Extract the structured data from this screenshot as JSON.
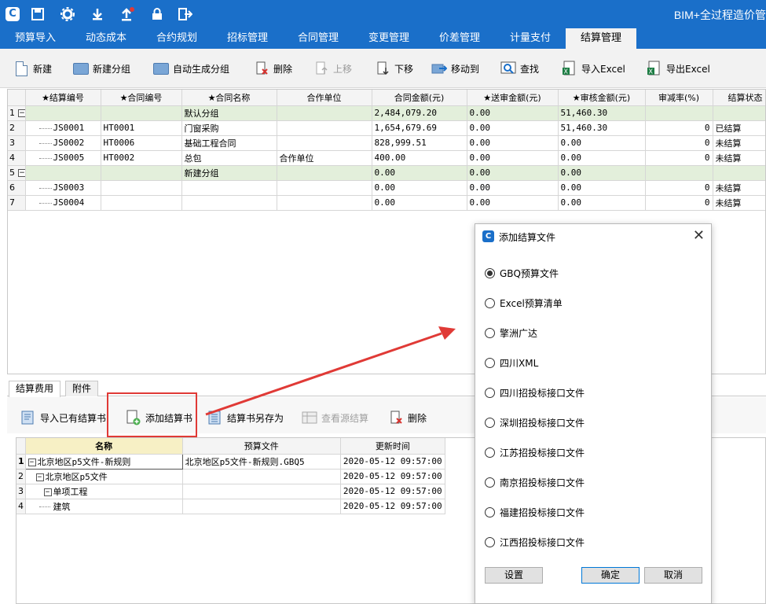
{
  "app_title": "BIM+全过程造价管",
  "menu": {
    "tabs": [
      "预算导入",
      "动态成本",
      "合约规划",
      "招标管理",
      "合同管理",
      "变更管理",
      "价差管理",
      "计量支付",
      "结算管理"
    ],
    "active_index": 8
  },
  "toolbar": {
    "new": "新建",
    "new_group": "新建分组",
    "auto_group": "自动生成分组",
    "delete": "删除",
    "move_up": "上移",
    "move_down": "下移",
    "move_to": "移动到",
    "find": "查找",
    "import_excel": "导入Excel",
    "export_excel": "导出Excel"
  },
  "top_grid": {
    "headers": [
      "★结算编号",
      "★合同编号",
      "★合同名称",
      "合作单位",
      "合同金额(元)",
      "★送审金额(元)",
      "★审核金额(元)",
      "审减率(%)",
      "结算状态"
    ],
    "rows": [
      {
        "n": "1",
        "group": true,
        "code": "",
        "contract": "",
        "name": "默认分组",
        "partner": "",
        "amount": "2,484,079.20",
        "submitted": "0.00",
        "audited": "51,460.30",
        "rate": "",
        "status": ""
      },
      {
        "n": "2",
        "group": false,
        "code": "JS0001",
        "contract": "HT0001",
        "name": "门窗采购",
        "partner": "",
        "amount": "1,654,679.69",
        "submitted": "0.00",
        "audited": "51,460.30",
        "rate": "0",
        "status": "已结算"
      },
      {
        "n": "3",
        "group": false,
        "code": "JS0002",
        "contract": "HT0006",
        "name": "基础工程合同",
        "partner": "",
        "amount": "828,999.51",
        "submitted": "0.00",
        "audited": "0.00",
        "rate": "0",
        "status": "未结算"
      },
      {
        "n": "4",
        "group": false,
        "code": "JS0005",
        "contract": "HT0002",
        "name": "总包",
        "partner": "合作单位",
        "amount": "400.00",
        "submitted": "0.00",
        "audited": "0.00",
        "rate": "0",
        "status": "未结算"
      },
      {
        "n": "5",
        "group": true,
        "code": "",
        "contract": "",
        "name": "新建分组",
        "partner": "",
        "amount": "0.00",
        "submitted": "0.00",
        "audited": "0.00",
        "rate": "",
        "status": ""
      },
      {
        "n": "6",
        "group": false,
        "code": "JS0003",
        "contract": "",
        "name": "",
        "partner": "",
        "amount": "0.00",
        "submitted": "0.00",
        "audited": "0.00",
        "rate": "0",
        "status": "未结算"
      },
      {
        "n": "7",
        "group": false,
        "code": "JS0004",
        "contract": "",
        "name": "",
        "partner": "",
        "amount": "0.00",
        "submitted": "0.00",
        "audited": "0.00",
        "rate": "0",
        "status": "未结算"
      }
    ]
  },
  "bottom_tabs": [
    "结算费用",
    "附件"
  ],
  "bottom_toolbar": {
    "import_existing": "导入已有结算书",
    "add_book": "添加结算书",
    "save_as": "结算书另存为",
    "view_source": "查看源结算",
    "delete": "删除"
  },
  "bottom_grid": {
    "headers": [
      "名称",
      "预算文件",
      "更新时间"
    ],
    "rows": [
      {
        "n": "1",
        "name": "北京地区p5文件-新规则",
        "file": "北京地区p5文件-新规则.GBQ5",
        "time": "2020-05-12 09:57:00",
        "level": 0
      },
      {
        "n": "2",
        "name": "北京地区p5文件",
        "file": "",
        "time": "2020-05-12 09:57:00",
        "level": 1
      },
      {
        "n": "3",
        "name": "单项工程",
        "file": "",
        "time": "2020-05-12 09:57:00",
        "level": 2
      },
      {
        "n": "4",
        "name": "建筑",
        "file": "",
        "time": "2020-05-12 09:57:00",
        "level": 3
      }
    ]
  },
  "dialog": {
    "title": "添加结算文件",
    "options": [
      "GBQ预算文件",
      "Excel预算清单",
      "擎洲广达",
      "四川XML",
      "四川招投标接口文件",
      "深圳招投标接口文件",
      "江苏招投标接口文件",
      "南京招投标接口文件",
      "福建招投标接口文件",
      "江西招投标接口文件"
    ],
    "selected_index": 0,
    "settings": "设置",
    "ok": "确定",
    "cancel": "取消"
  },
  "colors": {
    "brand": "#1a6fc9",
    "group_row": "#e3efdb",
    "highlight": "#e03a36"
  }
}
